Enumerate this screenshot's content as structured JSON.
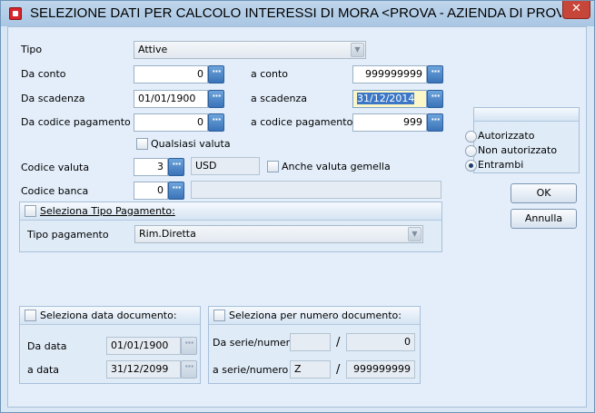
{
  "window": {
    "title": "SELEZIONE DATI PER CALCOLO INTERESSI DI MORA <PROVA - AZIENDA DI PROVA PRE...",
    "close": "✕"
  },
  "form": {
    "tipo_label": "Tipo",
    "tipo_value": "Attive",
    "da_conto_label": "Da conto",
    "da_conto_value": "0",
    "a_conto_label": "a conto",
    "a_conto_value": "999999999",
    "da_scadenza_label": "Da scadenza",
    "da_scadenza_value": "01/01/1900",
    "a_scadenza_label": "a scadenza",
    "a_scadenza_value": "31/12/2014",
    "da_codpag_label": "Da codice pagamento",
    "da_codpag_value": "0",
    "a_codpag_label": "a codice pagamento",
    "a_codpag_value": "999",
    "qualsiasi_valuta_label": "Qualsiasi valuta",
    "codice_valuta_label": "Codice valuta",
    "codice_valuta_value": "3",
    "valuta_desc": "USD",
    "anche_gemella_label": "Anche valuta gemella",
    "codice_banca_label": "Codice banca",
    "codice_banca_value": "0",
    "codice_banca_desc": "",
    "lookup_glyph": "···"
  },
  "tipo_pagamento_group": {
    "header": "Seleziona Tipo Pagamento:",
    "label": "Tipo pagamento",
    "value": "Rim.Diretta"
  },
  "auth_group": {
    "options": [
      {
        "label": "Autorizzato",
        "selected": false
      },
      {
        "label": "Non autorizzato",
        "selected": false
      },
      {
        "label": "Entrambi",
        "selected": true
      }
    ]
  },
  "buttons": {
    "ok": "OK",
    "annulla": "Annulla"
  },
  "data_doc_group": {
    "header": "Seleziona data documento:",
    "da_label": "Da data",
    "da_value": "01/01/1900",
    "a_label": "a data",
    "a_value": "31/12/2099"
  },
  "num_doc_group": {
    "header": "Seleziona per numero documento:",
    "da_label": "Da serie/numero",
    "da_serie": "",
    "da_numero": "0",
    "a_label": "a serie/numero",
    "a_serie": "Z",
    "a_numero": "999999999",
    "slash": "/"
  },
  "colors": {
    "window_bg": "#d9e7f4",
    "accent": "#3a73b8",
    "selection": "#3b77c6"
  }
}
